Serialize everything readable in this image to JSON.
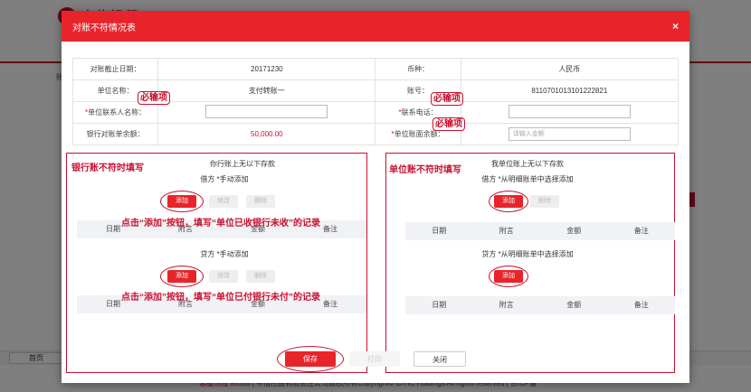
{
  "background": {
    "bank_name": "中信银行",
    "bank_mark": "中",
    "side_text": "账",
    "home_label": "首页",
    "footer_red": "客服热线 95558",
    "footer_text": " | 中信控股有限责任公司版权所有Copyright© CITIC Holdings All rights reserved | 京ICP备"
  },
  "modal": {
    "title": "对账不符情况表",
    "close_icon": "×"
  },
  "info": {
    "cutoff_label": "对账截止日期：",
    "cutoff_value": "20171230",
    "currency_label": "币种：",
    "currency_value": "人民币",
    "unit_label": "单位名称：",
    "unit_value": "支付转账一",
    "account_label": "账号：",
    "account_value": "8110701013101222821",
    "contact_req": "*",
    "contact_label": "单位联系人名称：",
    "contact_value": "",
    "phone_req": "*",
    "phone_label": "联系电话：",
    "phone_value": "",
    "bank_balance_label": "银行对账单余额：",
    "bank_balance_value": "50,000.00",
    "unit_balance_req": "*",
    "unit_balance_label": "单位账面余额：",
    "unit_balance_placeholder": "请输入金额"
  },
  "callouts": {
    "required": "必输项"
  },
  "left_panel": {
    "title": "银行账不符时填写",
    "subtitle": "你行账上无以下存款",
    "debit_label": "借方 *手动添加",
    "credit_label": "贷方 *手动添加",
    "add_label": "添加",
    "edit_label": "修改",
    "delete_label": "删除",
    "instr1": "点击“添加”按钮，填写“单位已收银行未收”的记录",
    "instr2": "点击“添加”按钮，填写“单位已付银行未付”的记录",
    "columns": [
      "日期",
      "附言",
      "金额",
      "备注"
    ]
  },
  "right_panel": {
    "title": "单位账不符时填写",
    "subtitle": "我单位账上无以下存款",
    "debit_label": "借方 *从明细账单中选择添加",
    "credit_label": "贷方 *从明细账单中选择添加",
    "add_label": "添加",
    "delete_label": "删除",
    "columns": [
      "日期",
      "附言",
      "金额",
      "备注"
    ]
  },
  "footer": {
    "save_label": "保存",
    "print_label": "打印",
    "close_label": "关闭"
  },
  "colors": {
    "brand_red": "#e8242b",
    "annotation_red": "#c8102e"
  }
}
